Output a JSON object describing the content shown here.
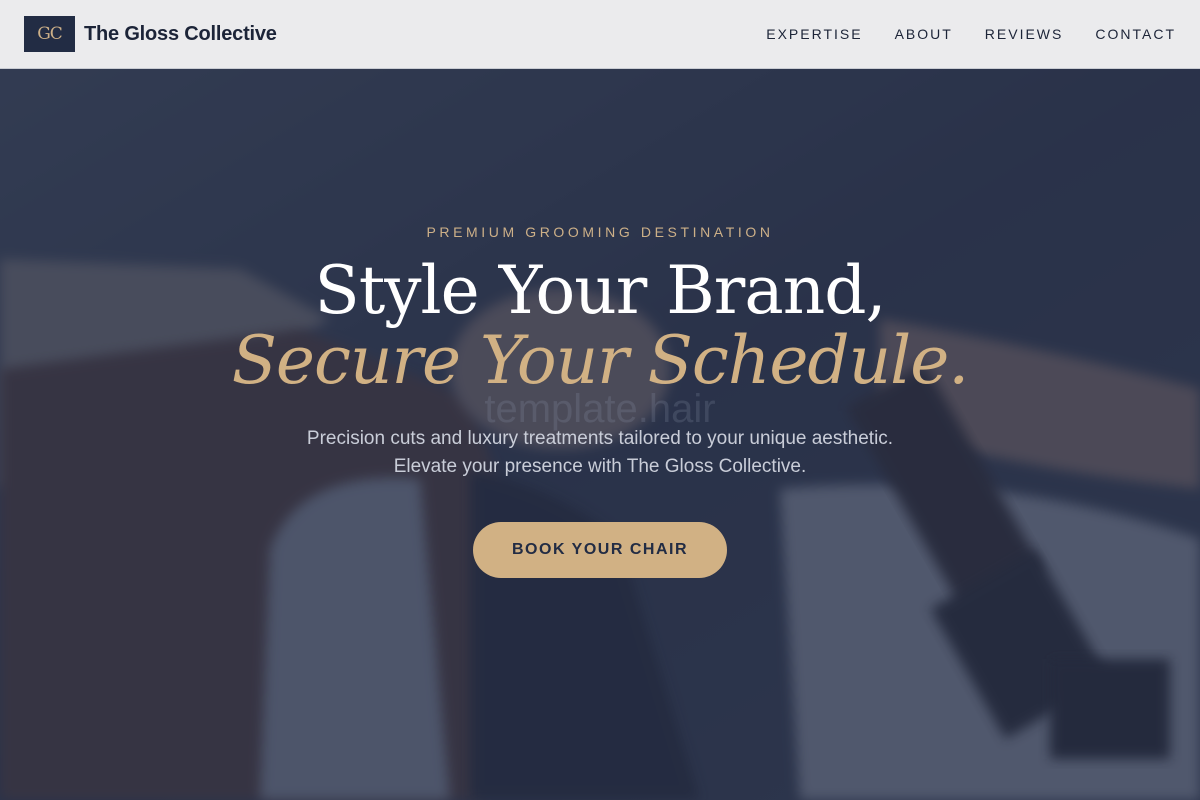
{
  "header": {
    "logo_monogram": "GC",
    "brand_name": "The Gloss Collective",
    "nav": [
      {
        "label": "EXPERTISE"
      },
      {
        "label": "ABOUT"
      },
      {
        "label": "REVIEWS"
      },
      {
        "label": "CONTACT"
      }
    ]
  },
  "hero": {
    "eyebrow": "PREMIUM GROOMING DESTINATION",
    "headline_line1": "Style Your Brand,",
    "headline_line2": "Secure Your Schedule.",
    "subtext_line1": "Precision cuts and luxury treatments tailored to your unique aesthetic.",
    "subtext_line2": "Elevate your presence with The Gloss Collective.",
    "cta_label": "BOOK YOUR CHAIR",
    "background_image": "salon-hair-wash-photo",
    "watermark_text": "template.hair"
  },
  "colors": {
    "navy": "#222c44",
    "gold": "#d1b184",
    "header_bg": "#ebebed"
  }
}
